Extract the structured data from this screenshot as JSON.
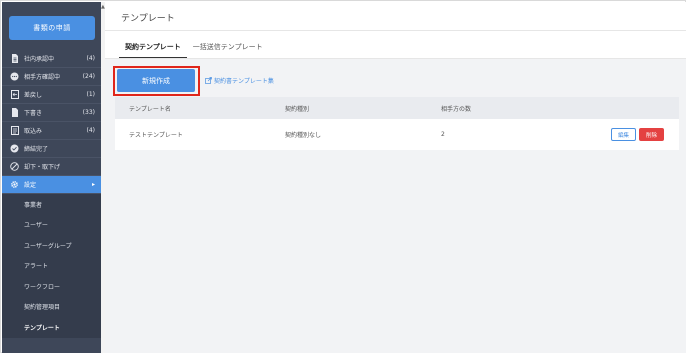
{
  "sidebar": {
    "apply_button": "書類の申請",
    "items": [
      {
        "label": "社内承認中",
        "count": "(4)",
        "icon": "document-icon"
      },
      {
        "label": "相手方確認中",
        "count": "(24)",
        "icon": "chat-icon"
      },
      {
        "label": "差戻し",
        "count": "(1)",
        "icon": "return-icon"
      },
      {
        "label": "下書き",
        "count": "(33)",
        "icon": "draft-icon"
      },
      {
        "label": "取込み",
        "count": "(4)",
        "icon": "import-icon"
      },
      {
        "label": "締結完了",
        "count": "",
        "icon": "check-circle-icon"
      },
      {
        "label": "却下・取下げ",
        "count": "",
        "icon": "ban-icon"
      },
      {
        "label": "設定",
        "count": "",
        "icon": "gear-icon"
      }
    ],
    "settings_items": [
      "事業者",
      "ユーザー",
      "ユーザーグループ",
      "アラート",
      "ワークフロー",
      "契約管理項目",
      "テンプレート"
    ]
  },
  "main": {
    "title": "テンプレート",
    "tabs": [
      "契約テンプレート",
      "一括送信テンプレート"
    ],
    "new_button": "新規作成",
    "template_link": "契約書テンプレート集",
    "table": {
      "columns": [
        "テンプレート名",
        "契約種別",
        "相手方の数"
      ],
      "rows": [
        {
          "name": "テストテンプレート",
          "type": "契約種別なし",
          "count": "2",
          "edit": "編集",
          "delete": "削除"
        }
      ]
    }
  },
  "colors": {
    "sidebar_bg": "#3e4759",
    "accent": "#4a90e2",
    "danger": "#e44141",
    "highlight_border": "#e0261b"
  }
}
